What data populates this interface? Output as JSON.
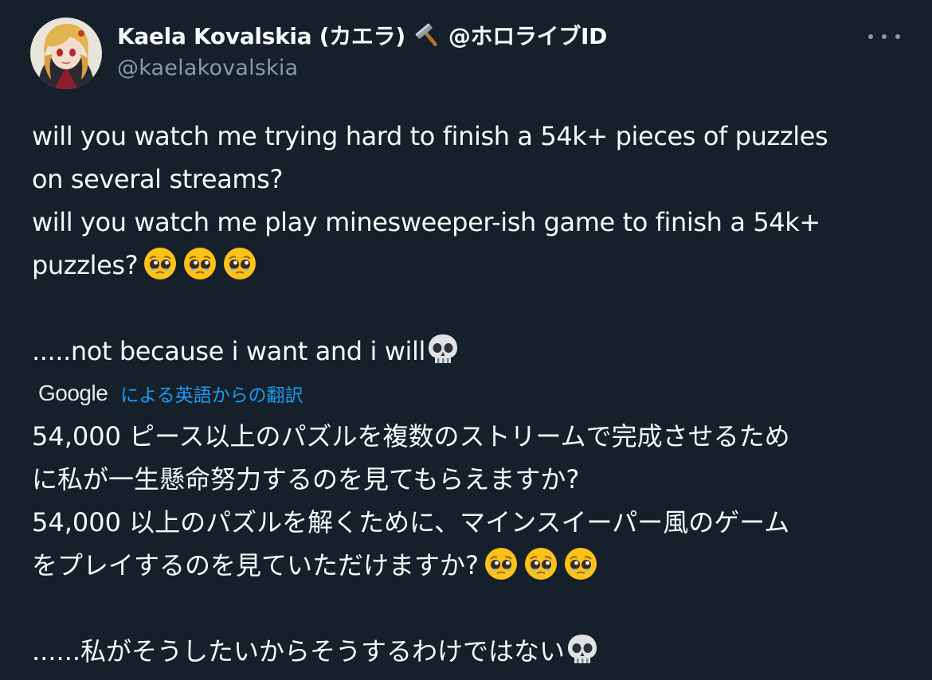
{
  "author": {
    "display_name": "Kaela Kovalskia (カエラ)",
    "name_emoji": "hammer-icon",
    "affiliation": "@ホロライブID",
    "handle": "@kaelakovalskia"
  },
  "tweet": {
    "lines": [
      "will you watch me trying hard to finish a 54k+ pieces of puzzles",
      "on several streams?",
      "will you watch me play minesweeper-ish game to finish a 54k+",
      "puzzles?",
      "",
      ".....not because i want and i will"
    ],
    "line4_emojis": [
      "pleading-face-icon",
      "pleading-face-icon",
      "pleading-face-icon"
    ],
    "line6_emoji": "skull-icon"
  },
  "translation": {
    "provider": "Google",
    "label": "による英語からの翻訳",
    "lines": [
      "54,000 ピース以上のパズルを複数のストリームで完成させるため",
      "に私が一生懸命努力するのを見てもらえますか?",
      "54,000 以上のパズルを解くために、マインスイーパー風のゲーム",
      "をプレイするのを見ていただけますか?",
      "",
      "......私がそうしたいからそうするわけではない"
    ]
  },
  "colors": {
    "background": "#15202b",
    "text": "#f7f9f9",
    "secondary": "#8b98a5",
    "link": "#1d9bf0"
  }
}
